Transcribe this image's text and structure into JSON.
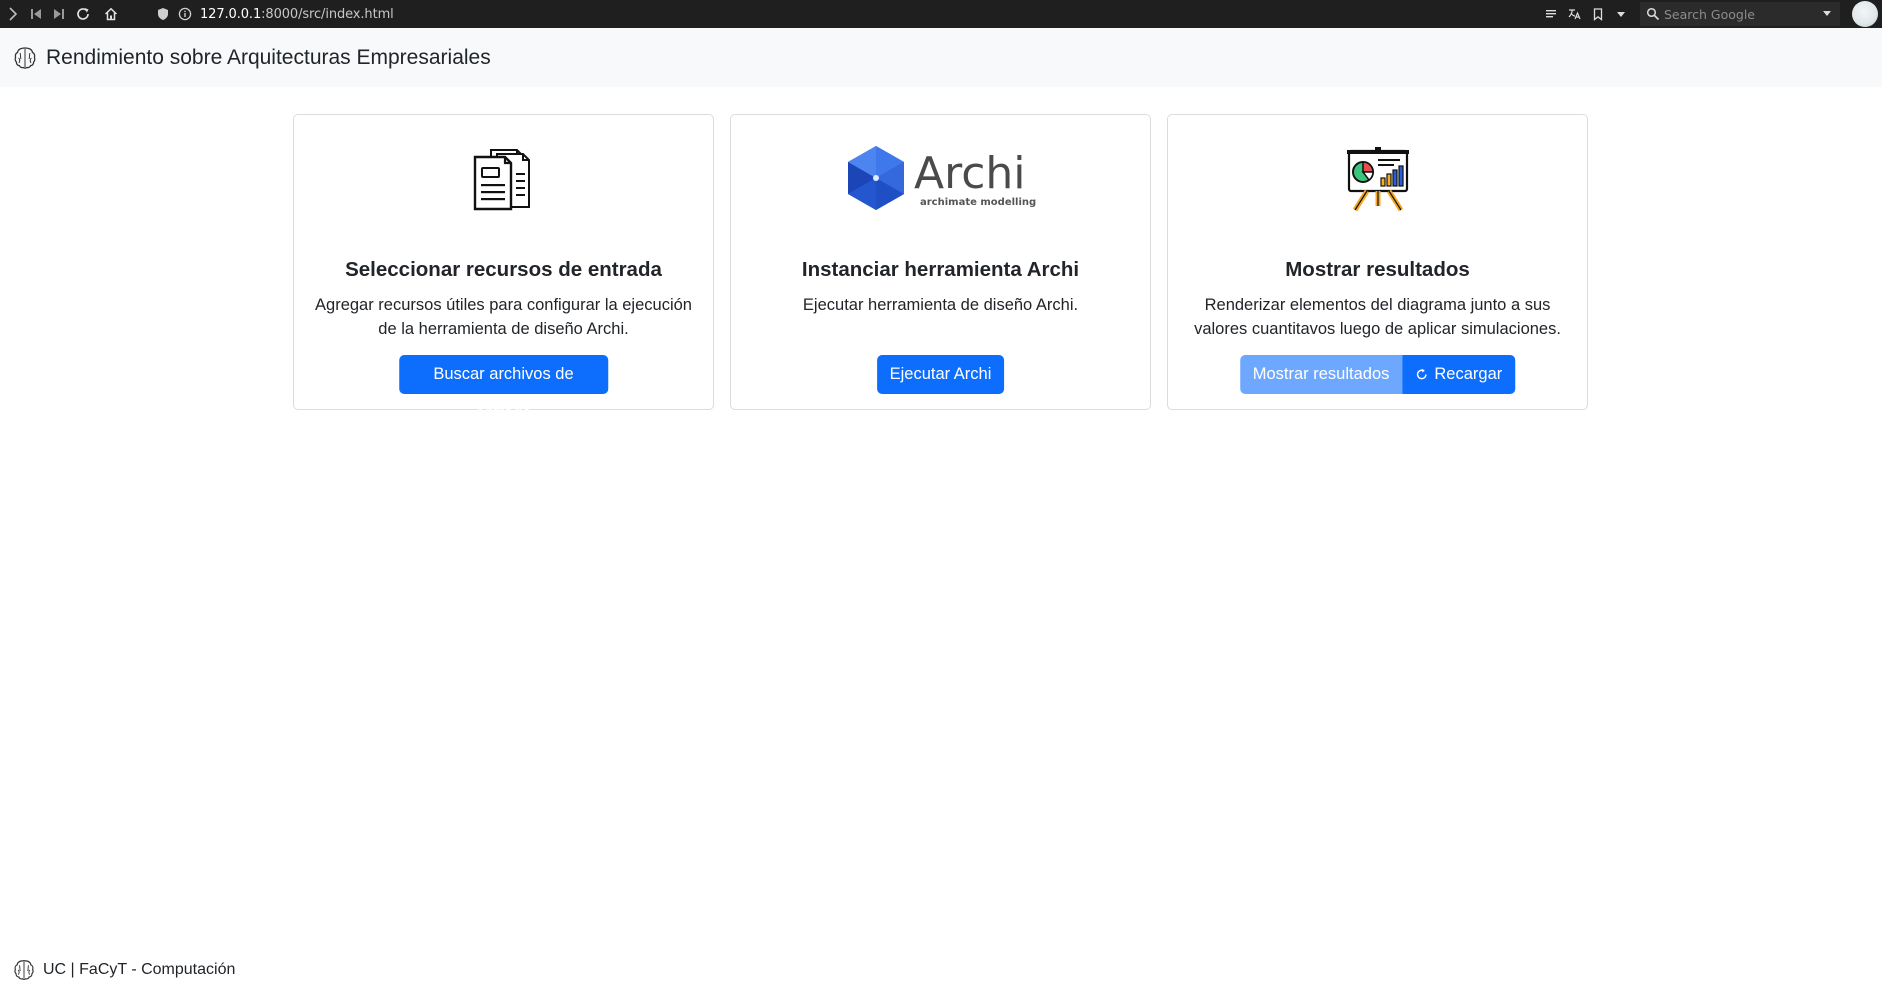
{
  "browser": {
    "url_host": "127.0.0.1",
    "url_rest": ":8000/src/index.html",
    "search_placeholder": "Search Google"
  },
  "header": {
    "title": "Rendimiento sobre Arquitecturas Empresariales",
    "icon": "brain-icon"
  },
  "cards": [
    {
      "icon": "documents-icon",
      "title": "Seleccionar recursos de entrada",
      "text": "Agregar recursos útiles para configurar la ejecución de la herramienta de diseño Archi.",
      "button": "Buscar archivos de entrada"
    },
    {
      "icon": "archi-logo",
      "logo_text": "Archi",
      "logo_sub": "archimate modelling",
      "title": "Instanciar herramienta Archi",
      "text": "Ejecutar herramienta de diseño Archi.",
      "button": "Ejecutar Archi"
    },
    {
      "icon": "presentation-chart-icon",
      "title": "Mostrar resultados",
      "text": "Renderizar elementos del diagrama junto a sus valores cuantitavos luego de aplicar simulaciones.",
      "button_primary": "Mostrar resultados",
      "button_secondary": "Recargar"
    }
  ],
  "footer": {
    "text": "UC | FaCyT - Computación"
  },
  "colors": {
    "primary": "#0d6efd",
    "primary_disabled": "#6ea8fe",
    "header_bg": "#f8f9fa",
    "archi_blue": "#2a5ed6"
  }
}
